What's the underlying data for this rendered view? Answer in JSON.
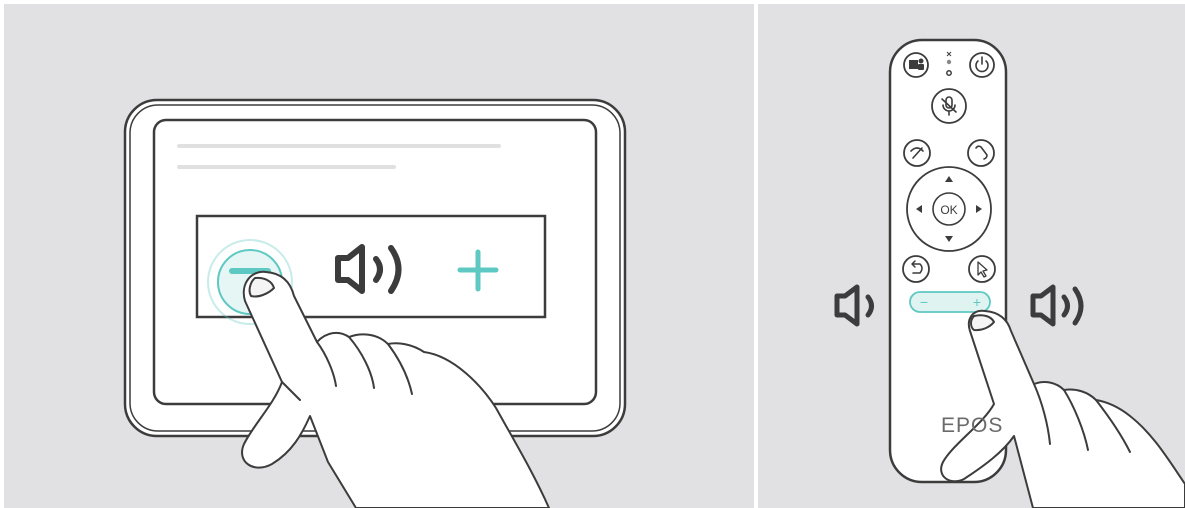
{
  "illustration": {
    "left_scene": "touch-panel-volume-control",
    "right_scene": "remote-control-volume-control"
  },
  "colors": {
    "background": "#e1e1e3",
    "outline": "#3c3c3c",
    "accent": "#5ec8c2",
    "accent_fill": "#dff3f1",
    "placeholder_line": "#e0e0e0"
  },
  "touch_panel": {
    "volume_down_label": "−",
    "volume_up_label": "+",
    "speaker_icon": "speaker-volume-icon"
  },
  "remote": {
    "brand": "EPOS",
    "ok_label": "OK",
    "volume_minus_label": "−",
    "volume_plus_label": "+",
    "icons": [
      "teams-icon",
      "mute-indicator-icon",
      "power-icon",
      "microphone-mute-icon",
      "hang-up-icon",
      "call-icon",
      "arrow-up-icon",
      "arrow-left-icon",
      "arrow-right-icon",
      "arrow-down-icon",
      "back-icon",
      "cursor-icon"
    ],
    "left_speaker_icon": "speaker-low-icon",
    "right_speaker_icon": "speaker-high-icon"
  }
}
